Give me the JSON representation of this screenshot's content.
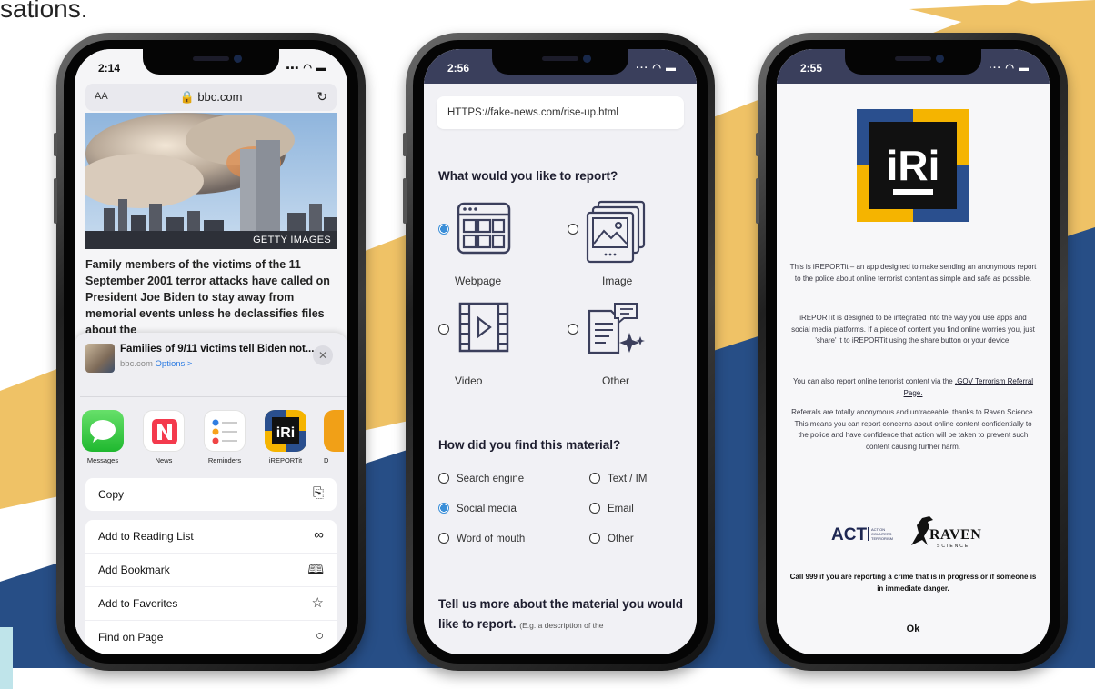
{
  "caption": "sations.",
  "phone1": {
    "time": "2:14",
    "text_size_label": "AA",
    "url": "bbc.com",
    "photo_credit": "GETTY IMAGES",
    "headline": "Family members of the victims of the 11 September 2001 terror attacks have called on President Joe Biden to stay away from memorial events unless he declassifies files about the",
    "share": {
      "title": "Families of 9/11 victims tell Biden not...",
      "source": "bbc.com",
      "options": "Options >",
      "close": "✕"
    },
    "apps": [
      {
        "label": "Messages"
      },
      {
        "label": "News"
      },
      {
        "label": "Reminders"
      },
      {
        "label": "iREPORTit"
      },
      {
        "label": "D"
      }
    ],
    "actions": [
      {
        "label": "Copy",
        "icon": "copy-icon"
      },
      {
        "label": "Add to Reading List",
        "icon": "glasses-icon"
      },
      {
        "label": "Add Bookmark",
        "icon": "book-icon"
      },
      {
        "label": "Add to Favorites",
        "icon": "star-icon"
      },
      {
        "label": "Find on Page",
        "icon": "search-icon"
      }
    ]
  },
  "phone2": {
    "time": "2:56",
    "url": "HTTPS://fake-news.com/rise-up.html",
    "question1": "What would you like to report?",
    "report_types": [
      {
        "label": "Webpage",
        "selected": true
      },
      {
        "label": "Image",
        "selected": false
      },
      {
        "label": "Video",
        "selected": false
      },
      {
        "label": "Other",
        "selected": false
      }
    ],
    "question2": "How did you find this material?",
    "sources": [
      {
        "label": "Search engine",
        "selected": false
      },
      {
        "label": "Text / IM",
        "selected": false
      },
      {
        "label": "Social media",
        "selected": true
      },
      {
        "label": "Email",
        "selected": false
      },
      {
        "label": "Word of mouth",
        "selected": false
      },
      {
        "label": "Other",
        "selected": false
      }
    ],
    "question3": "Tell us more about the material you would like to report.",
    "question3_hint": "(E.g. a description of the"
  },
  "phone3": {
    "time": "2:55",
    "logo_text": "iRi",
    "para1": "This is iREPORTit – an app designed to make sending an anonymous report to the police about online terrorist content as simple and safe as possible.",
    "para2": "iREPORTit is designed to be integrated into the way you use apps and social media platforms. If a piece of content you find online worries you, just 'share' it to iREPORTit using the share button or your device.",
    "para3_prefix": "You can also report online terrorist content via the ",
    "para3_link": ".GOV Terrorism Referral Page.",
    "para4": "Referrals are totally anonymous and untraceable, thanks to Raven Science. This means you can report concerns about online content confidentially to the police and have confidence that action will be taken to prevent such content causing further harm.",
    "act_logo": "ACT",
    "act_sub1": "ACTION",
    "act_sub2": "COUNTERS",
    "act_sub3": "TERRORISM",
    "raven_logo": "RAVEN",
    "raven_sub": "SCIENCE",
    "warning": "Call 999 if you are reporting a crime that is in progress or if someone is in immediate danger.",
    "ok": "Ok"
  },
  "colors": {
    "gold": "#efc266",
    "navy": "#274e86",
    "iri_yellow": "#f5b400",
    "iri_blue": "#2a4f8e"
  }
}
